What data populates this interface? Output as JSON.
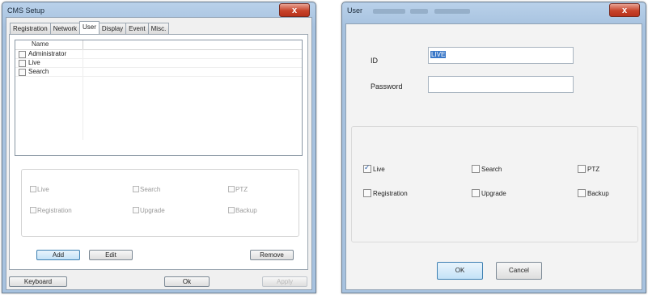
{
  "cms": {
    "title": "CMS Setup",
    "close": "x",
    "tabs": [
      "Registration",
      "Network",
      "User",
      "Display",
      "Event",
      "Misc."
    ],
    "list_header": "Name",
    "users": [
      "Administrator",
      "Live",
      "Search"
    ],
    "permissions": [
      "Live",
      "Search",
      "PTZ",
      "Registration",
      "Upgrade",
      "Backup"
    ],
    "buttons": {
      "add": "Add",
      "edit": "Edit",
      "remove": "Remove"
    },
    "footer": {
      "keyboard": "Keyboard",
      "ok": "Ok",
      "apply": "Apply"
    }
  },
  "user_dialog": {
    "title": "User",
    "close": "x",
    "id_label": "ID",
    "id_value": "LIVE",
    "password_label": "Password",
    "permissions": [
      {
        "label": "Live",
        "checked": true
      },
      {
        "label": "Search",
        "checked": false
      },
      {
        "label": "PTZ",
        "checked": false
      },
      {
        "label": "Registration",
        "checked": false
      },
      {
        "label": "Upgrade",
        "checked": false
      },
      {
        "label": "Backup",
        "checked": false
      }
    ],
    "buttons": {
      "ok": "OK",
      "cancel": "Cancel"
    }
  }
}
